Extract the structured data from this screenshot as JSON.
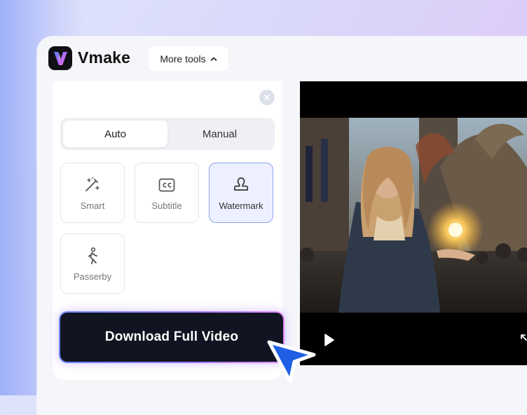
{
  "app": {
    "name": "Vmake"
  },
  "header": {
    "more_tools_label": "More tools"
  },
  "panel": {
    "mode_tabs": [
      {
        "label": "Auto",
        "active": true
      },
      {
        "label": "Manual",
        "active": false
      }
    ],
    "tools": [
      {
        "label": "Smart",
        "icon": "magic-wand-icon",
        "selected": false
      },
      {
        "label": "Subtitle",
        "icon": "cc-icon",
        "selected": false
      },
      {
        "label": "Watermark",
        "icon": "stamp-icon",
        "selected": true
      },
      {
        "label": "Passerby",
        "icon": "walking-person-icon",
        "selected": false
      }
    ],
    "download_label": "Download Full Video"
  },
  "video": {
    "controls": [
      "play-icon",
      "expand-icon"
    ]
  },
  "colors": {
    "accent": "#8fa3ee",
    "download_bg": "#111521",
    "glow_start": "#6d88ff",
    "glow_end": "#e38bff",
    "cursor": "#1f5fe6"
  }
}
